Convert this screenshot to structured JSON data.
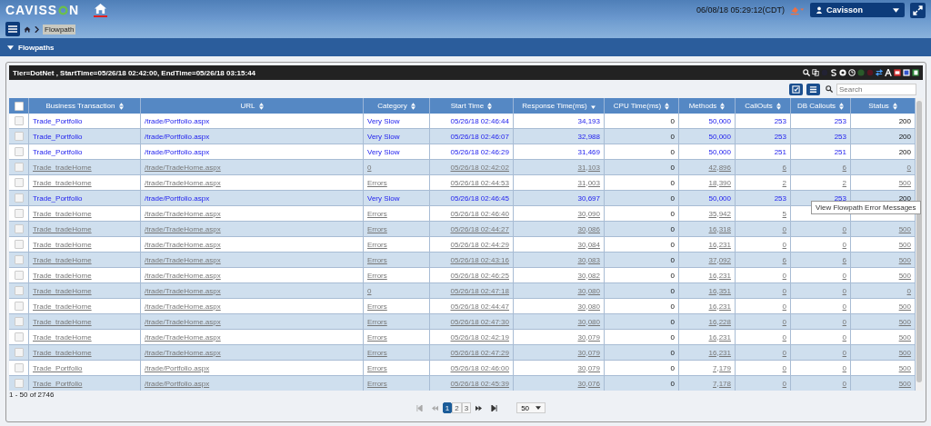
{
  "header": {
    "logo_parts": [
      "CAVISS",
      "N"
    ],
    "datetime": "06/08/18 05:29:12(CDT)",
    "user": "Cavisson"
  },
  "breadcrumb": {
    "current": "Flowpath"
  },
  "panel": {
    "title": "Flowpaths",
    "filter": "Tier=DotNet , StartTime=05/26/18 02:42:00, EndTime=05/26/18 03:15:44"
  },
  "search": {
    "placeholder": "Search"
  },
  "table": {
    "columns": [
      {
        "label": "Business Transaction",
        "sorted": false
      },
      {
        "label": "URL",
        "sorted": false
      },
      {
        "label": "Category",
        "sorted": false
      },
      {
        "label": "Start Time",
        "sorted": false
      },
      {
        "label": "Response Time(ms)",
        "sorted": true
      },
      {
        "label": "CPU Time(ms)",
        "sorted": false
      },
      {
        "label": "Methods",
        "sorted": false
      },
      {
        "label": "CallOuts",
        "sorted": false
      },
      {
        "label": "DB Callouts",
        "sorted": false
      },
      {
        "label": "Status",
        "sorted": false
      }
    ],
    "select_all": {
      "checked": false
    },
    "rows": [
      {
        "kind": "slow",
        "checked": false,
        "cells": [
          "Trade_Portfolio",
          "/trade/Portfolio.aspx",
          "Very Slow",
          "05/26/18 02:46:44",
          "34,193",
          "0",
          "50,000",
          "253",
          "253",
          "200"
        ]
      },
      {
        "kind": "slow",
        "checked": false,
        "cells": [
          "Trade_Portfolio",
          "/trade/Portfolio.aspx",
          "Very Slow",
          "05/26/18 02:46:07",
          "32,988",
          "0",
          "50,000",
          "253",
          "253",
          "200"
        ]
      },
      {
        "kind": "slow",
        "checked": false,
        "cells": [
          "Trade_Portfolio",
          "/trade/Portfolio.aspx",
          "Very Slow",
          "05/26/18 02:46:29",
          "31,469",
          "0",
          "50,000",
          "251",
          "251",
          "200"
        ]
      },
      {
        "kind": "error",
        "checked": false,
        "cells": [
          "Trade_tradeHome",
          "/trade/TradeHome.aspx",
          "0",
          "05/26/18 02:42:02",
          "31,103",
          "0",
          "42,896",
          "6",
          "6",
          "0"
        ]
      },
      {
        "kind": "error",
        "checked": false,
        "cells": [
          "Trade_tradeHome",
          "/trade/TradeHome.aspx",
          "Errors",
          "05/26/18 02:44:53",
          "31,003",
          "0",
          "18,390",
          "2",
          "2",
          "500"
        ]
      },
      {
        "kind": "slow",
        "checked": false,
        "cells": [
          "Trade_Portfolio",
          "/trade/Portfolio.aspx",
          "Very Slow",
          "05/26/18 02:46:45",
          "30,697",
          "0",
          "50,000",
          "253",
          "253",
          "200"
        ]
      },
      {
        "kind": "error",
        "checked": false,
        "cells": [
          "Trade_tradeHome",
          "/trade/TradeHome.aspx",
          "Errors",
          "05/26/18 02:46:40",
          "30,090",
          "0",
          "35,942",
          "5",
          null,
          null
        ]
      },
      {
        "kind": "error",
        "checked": false,
        "cells": [
          "Trade_tradeHome",
          "/trade/TradeHome.aspx",
          "Errors",
          "05/26/18 02:44:27",
          "30,086",
          "0",
          "16,318",
          "0",
          "0",
          "500"
        ]
      },
      {
        "kind": "error",
        "checked": false,
        "cells": [
          "Trade_tradeHome",
          "/trade/TradeHome.aspx",
          "Errors",
          "05/26/18 02:44:29",
          "30,084",
          "0",
          "16,231",
          "0",
          "0",
          "500"
        ]
      },
      {
        "kind": "error",
        "checked": false,
        "cells": [
          "Trade_tradeHome",
          "/trade/TradeHome.aspx",
          "Errors",
          "05/26/18 02:43:16",
          "30,083",
          "0",
          "37,092",
          "6",
          "6",
          "500"
        ]
      },
      {
        "kind": "error",
        "checked": false,
        "cells": [
          "Trade_tradeHome",
          "/trade/TradeHome.aspx",
          "Errors",
          "05/26/18 02:46:25",
          "30,082",
          "0",
          "16,231",
          "0",
          "0",
          "500"
        ]
      },
      {
        "kind": "error",
        "checked": false,
        "cells": [
          "Trade_tradeHome",
          "/trade/TradeHome.aspx",
          "0",
          "05/26/18 02:47:18",
          "30,080",
          "0",
          "16,351",
          "0",
          "0",
          "0"
        ]
      },
      {
        "kind": "error",
        "checked": false,
        "cells": [
          "Trade_tradeHome",
          "/trade/TradeHome.aspx",
          "Errors",
          "05/26/18 02:44:47",
          "30,080",
          "0",
          "16,231",
          "0",
          "0",
          "500"
        ]
      },
      {
        "kind": "error",
        "checked": false,
        "cells": [
          "Trade_tradeHome",
          "/trade/TradeHome.aspx",
          "Errors",
          "05/26/18 02:47:30",
          "30,080",
          "0",
          "16,228",
          "0",
          "0",
          "500"
        ]
      },
      {
        "kind": "error",
        "checked": false,
        "cells": [
          "Trade_tradeHome",
          "/trade/TradeHome.aspx",
          "Errors",
          "05/26/18 02:42:19",
          "30,079",
          "0",
          "16,231",
          "0",
          "0",
          "500"
        ]
      },
      {
        "kind": "error",
        "checked": false,
        "cells": [
          "Trade_tradeHome",
          "/trade/TradeHome.aspx",
          "Errors",
          "05/26/18 02:47:29",
          "30,079",
          "0",
          "16,231",
          "0",
          "0",
          "500"
        ]
      },
      {
        "kind": "error",
        "checked": false,
        "cells": [
          "Trade_Portfolio",
          "/trade/Portfolio.aspx",
          "Errors",
          "05/26/18 02:46:00",
          "30,079",
          "0",
          "7,179",
          "0",
          "0",
          "500"
        ]
      },
      {
        "kind": "error",
        "checked": false,
        "cells": [
          "Trade_Portfolio",
          "/trade/Portfolio.aspx",
          "Errors",
          "05/26/18 02:45:39",
          "30,076",
          "0",
          "7,178",
          "0",
          "0",
          "500"
        ]
      }
    ]
  },
  "tooltip": "View Flowpath Error Messages",
  "footer": {
    "range": "1 - 50 of 2746",
    "pages": [
      {
        "label": "1",
        "selected": true
      },
      {
        "label": "2",
        "selected": false
      },
      {
        "label": "3",
        "selected": false
      }
    ],
    "page_size": "50"
  }
}
